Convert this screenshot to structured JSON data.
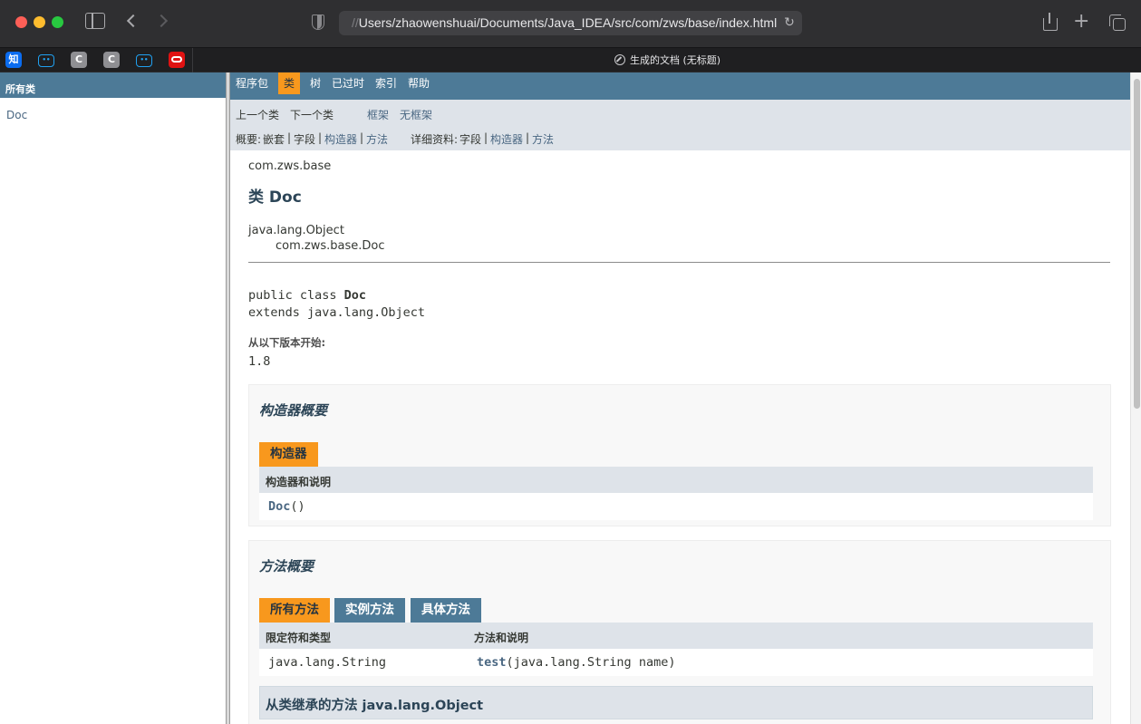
{
  "browser": {
    "url_prefix": "//",
    "url": "Users/zhaowenshuai/Documents/Java_IDEA/src/com/zws/base/index.html",
    "tab_title": "生成的文档 (无标题)",
    "favorites": [
      {
        "label": "知",
        "name": "zhihu-favicon"
      },
      {
        "label": "bili",
        "name": "bilibili-favicon"
      },
      {
        "label": "C",
        "name": "c-favicon"
      },
      {
        "label": "C",
        "name": "c-favicon-2"
      },
      {
        "label": "bili",
        "name": "bilibili-favicon-2"
      },
      {
        "label": "",
        "name": "oracle-favicon"
      }
    ],
    "icons": [
      "sidebar-icon",
      "back-icon",
      "forward-icon",
      "shield-icon",
      "reload-icon",
      "share-icon",
      "plus-icon",
      "tabs-overview-icon",
      "compass-icon"
    ]
  },
  "left_frame": {
    "heading": "所有类",
    "classes": [
      "Doc"
    ]
  },
  "topnav": {
    "items": [
      "程序包",
      "类",
      "树",
      "已过时",
      "索引",
      "帮助"
    ],
    "active": "类"
  },
  "subnav": {
    "prev": "上一个类",
    "next": "下一个类",
    "frames": "框架",
    "no_frames": "无框架",
    "summary_label": "概要:",
    "summary_nested": "嵌套",
    "summary_field": "字段",
    "summary_constructor": "构造器",
    "summary_method": "方法",
    "detail_label": "详细资料:",
    "detail_field": "字段",
    "detail_constructor": "构造器",
    "detail_method": "方法",
    "sep": "|"
  },
  "content": {
    "package": "com.zws.base",
    "title": "类 Doc",
    "inheritance_root": "java.lang.Object",
    "inheritance_child": "com.zws.base.Doc",
    "decl_prefix": "public class ",
    "decl_name": "Doc",
    "decl_extends": "extends java.lang.Object",
    "since_label": "从以下版本开始:",
    "since_value": "1.8"
  },
  "constructor_summary": {
    "heading": "构造器概要",
    "caption": "构造器",
    "column": "构造器和说明",
    "rows": [
      {
        "name": "Doc",
        "params": "()"
      }
    ]
  },
  "method_summary": {
    "heading": "方法概要",
    "captions": [
      "所有方法",
      "实例方法",
      "具体方法"
    ],
    "active_caption": "所有方法",
    "columns": [
      "限定符和类型",
      "方法和说明"
    ],
    "rows": [
      {
        "type": "java.lang.String",
        "name": "test",
        "params": "(java.lang.String name)"
      }
    ],
    "inherited_heading": "从类继承的方法 java.lang.Object"
  }
}
